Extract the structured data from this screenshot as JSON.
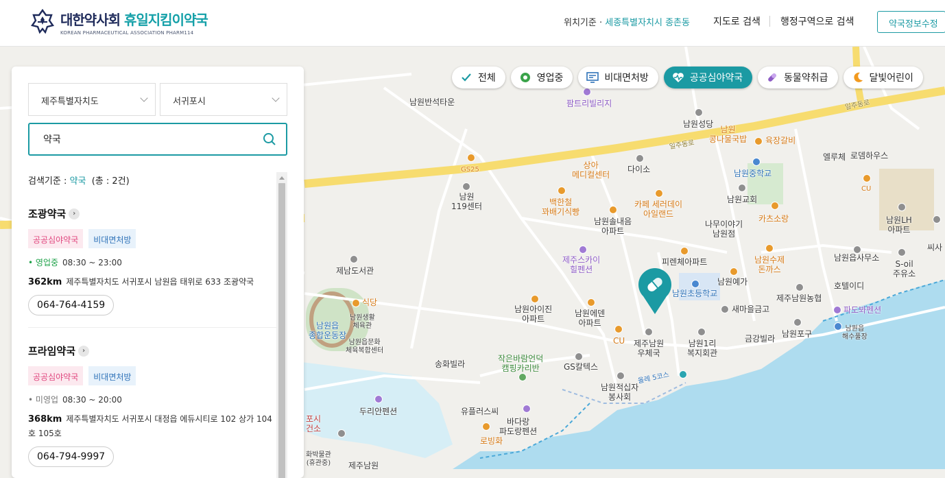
{
  "header": {
    "logo_title_ko": "대한약사회",
    "logo_title_teal": "휴일지킴이약국",
    "logo_subtitle": "KOREAN PHARMACEUTICAL ASSOCIATION PHARM114",
    "location_label": "위치기준 · ",
    "location_value": "세종특별자치시 종촌동",
    "nav_map_search": "지도로 검색",
    "nav_region_search": "행정구역으로 검색",
    "edit_button": "약국정보수정"
  },
  "filters": [
    {
      "label": "전체",
      "icon": "check-icon",
      "active": false
    },
    {
      "label": "영업중",
      "icon": "open-clock-icon",
      "active": false
    },
    {
      "label": "비대면처방",
      "icon": "monitor-prescription-icon",
      "active": false
    },
    {
      "label": "공공심야약국",
      "icon": "heart-pulse-icon",
      "active": true
    },
    {
      "label": "동물약취급",
      "icon": "capsule-icon",
      "active": false
    },
    {
      "label": "달빛어린이",
      "icon": "moon-icon",
      "active": false
    }
  ],
  "panel": {
    "province": "제주특별자치도",
    "city": "서귀포시",
    "search_value": "약국",
    "criteria_label": "검색기준 : ",
    "criteria_keyword": "약국",
    "criteria_count": "(총 : 2건)",
    "results": [
      {
        "name": "조광약국",
        "tags": [
          "공공심야약국",
          "비대면처방"
        ],
        "status": "영업중",
        "hours": "08:30 ~ 23:00",
        "distance": "362km",
        "address": "제주특별자치도 서귀포시 남원읍 태위로 633 조광약국",
        "phone": "064-764-4159"
      },
      {
        "name": "프라임약국",
        "tags": [
          "공공심야약국",
          "비대면처방"
        ],
        "status": "미영업",
        "hours": "08:30 ~ 20:00",
        "distance": "368km",
        "address": "제주특별자치도 서귀포시 대정읍 에듀시티로 102 상가 104호 105호",
        "phone": "064-794-9997"
      }
    ]
  },
  "map_labels": {
    "namwon_banseok": "남원반석타운",
    "pamtree": "팜트리빌리지",
    "namwon_church_top": "남원성당",
    "kongnamul": "남원\n콩나물국밥",
    "yukjang": "육장갈비",
    "iljudongro_1": "일주동로",
    "iljudongro_2": "일주동로",
    "gs25": "GS25",
    "sangga_medical": "상아\n메디컬센터",
    "daiso": "다이소",
    "namwon_middle": "남원중학교",
    "elrouche": "엘루체",
    "rotem": "로뎀하우스",
    "cu_top": "CU",
    "namwon_119": "남원\n119센터",
    "baekhancheol": "백한철\n꽈배기식빵",
    "cafe_serde": "카페 세러데이\n아일랜드",
    "namwon_church": "남원교회",
    "katsu_sora": "카츠소랑",
    "namwon_lh": "남원LH\n아파트",
    "naemulg": "남원솔내음\n아파트",
    "namu": "나무이야기\n남원점",
    "jeju_sky": "제주스카이\n힐펜션",
    "pirenche": "피렌체아파트",
    "namwon_suje": "남원수제\n돈까스",
    "namwon_office": "남원읍사무소",
    "soil": "S-oil\n주유소",
    "jenam_library": "제남도서관",
    "namwon_yega": "남원예가",
    "hotel_idi": "호텔이디",
    "namwon_elem": "남원초등학교",
    "namwon_nonghyup": "제주남원농협",
    "sikdang": "식당",
    "namwon_sports": "남원읍\n종합운동장",
    "namwon_gym": "남원생활\n체육관",
    "namwon_culture": "남원읍문화\n체육복합센터",
    "aijin": "남원아이진\n아파트",
    "eden": "남원에덴\n아파트",
    "saemaeul": "새마을금고",
    "padoba": "파도봐펜션",
    "geumgang": "금강빌라",
    "namwon_port": "남원포구",
    "haesu": "남원읍\n해수풀장",
    "cu_mid": "CU",
    "post": "제주남원\n우체국",
    "welfare": "남원1리\n복지회관",
    "songhwa": "송화빌라",
    "small_wind": "작은바람언덕\n캠핑카리반",
    "gs_caltex": "GS칼텍스",
    "redcross": "남원적십자\n봉사회",
    "durian": "두리안펜션",
    "eupflus": "유플러스씨",
    "badarang": "바다랑\n파도랑펜션",
    "robing": "로빙화",
    "seogwipo_health": "포시\n건소",
    "museum": "화박물관\n(휴관중)",
    "jeju_namwon_bottom": "제주남원",
    "olle": "올레 5코스",
    "ssi": "씨사"
  },
  "colors": {
    "accent": "#1b9aa3",
    "road_major": "#f7dc6f",
    "sea": "#aedcef",
    "map_land": "#f1f0ec"
  }
}
